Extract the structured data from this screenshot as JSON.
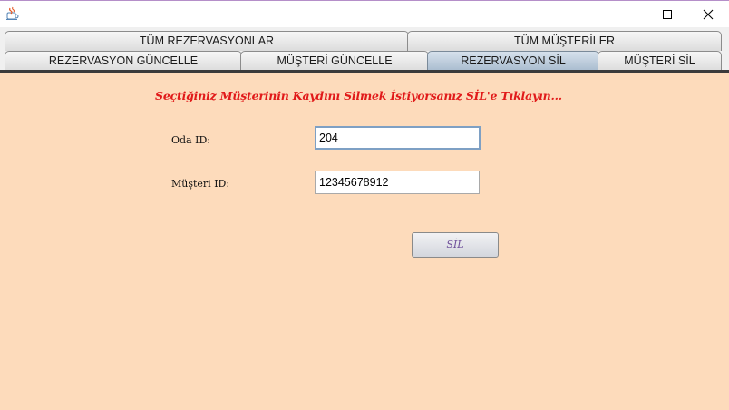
{
  "window": {
    "icon": "java-cup-icon",
    "controls": {
      "minimize": "minimize-icon",
      "maximize": "maximize-icon",
      "close": "close-icon"
    }
  },
  "tabs": {
    "row1": [
      {
        "label": "TÜM REZERVASYONLAR",
        "selected": false
      },
      {
        "label": "TÜM MÜŞTERİLER",
        "selected": false
      }
    ],
    "row2": [
      {
        "label": "REZERVASYON GÜNCELLE",
        "selected": false
      },
      {
        "label": "MÜŞTERİ GÜNCELLE",
        "selected": false
      },
      {
        "label": "REZERVASYON SİL",
        "selected": true
      },
      {
        "label": "MÜŞTERİ SİL",
        "selected": false
      }
    ]
  },
  "form": {
    "heading": "Seçtiğiniz Müşterinin Kaydını Silmek İstiyorsanız SİL'e Tıklayın...",
    "room_id_label": "Oda ID:",
    "room_id_value": "204",
    "customer_id_label": "Müşteri ID:",
    "customer_id_value": "12345678912",
    "delete_label": "SİL"
  },
  "colors": {
    "content_background": "#fddbbb",
    "heading": "#e11a1a",
    "button_text": "#6e4f9a",
    "selected_tab": "#a9bccf"
  }
}
